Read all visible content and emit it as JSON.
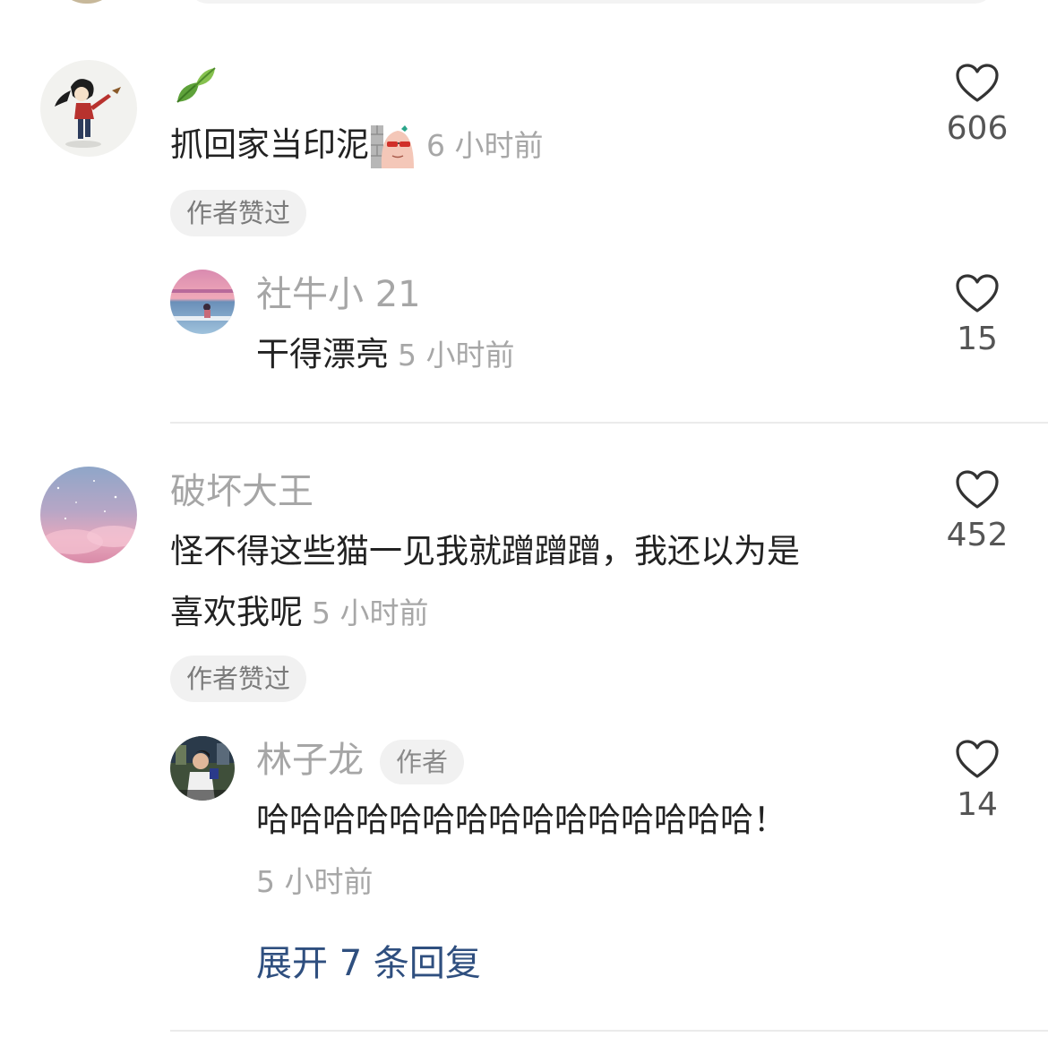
{
  "colors": {
    "username": "#a6a6a6",
    "text": "#222222",
    "time": "#a7a7a7",
    "link": "#2f4f7f",
    "pill_bg": "#f1f1f1",
    "divider": "#ebebeb"
  },
  "comments": [
    {
      "username_icon": "leaf-emoji-icon",
      "text": "抓回家当印泥",
      "inline_emoji": "sticker-emoji-icon",
      "time": "6 小时前",
      "badge": "作者赞过",
      "likes": "606",
      "reply": {
        "username": "社牛小 21",
        "text": "干得漂亮",
        "time": "5 小时前",
        "likes": "15"
      }
    },
    {
      "username": "破坏大王",
      "text_line1": "怪不得这些猫一见我就蹭蹭蹭，我还以为是",
      "text_line2": "喜欢我呢",
      "time": "5 小时前",
      "badge": "作者赞过",
      "likes": "452",
      "reply": {
        "username": "林子龙",
        "author_tag": "作者",
        "text": "哈哈哈哈哈哈哈哈哈哈哈哈哈哈哈！",
        "time": "5 小时前",
        "likes": "14"
      },
      "expand_label": "展开 7 条回复"
    }
  ]
}
